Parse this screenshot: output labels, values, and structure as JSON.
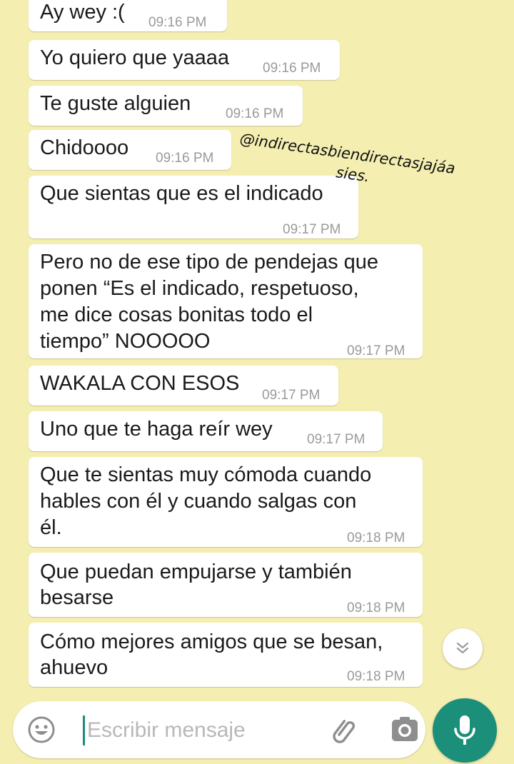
{
  "messages": [
    {
      "text": "Ay wey :(",
      "time": "09:16 PM"
    },
    {
      "text": "Yo quiero que yaaaa",
      "time": "09:16 PM"
    },
    {
      "text": "Te guste alguien",
      "time": "09:16 PM"
    },
    {
      "text": "Chidoooo",
      "time": "09:16 PM"
    },
    {
      "text": "Que sientas que es el indicado",
      "time": "09:17 PM"
    },
    {
      "lines": [
        "Pero no de ese tipo de pendejas que",
        "ponen “Es el indicado, respetuoso,",
        "me dice cosas bonitas todo el",
        "tiempo” NOOOOO"
      ],
      "time": "09:17 PM"
    },
    {
      "text": "WAKALA CON ESOS",
      "time": "09:17 PM"
    },
    {
      "text": "Uno que te haga reír wey",
      "time": "09:17 PM"
    },
    {
      "lines": [
        "Que te sientas muy cómoda cuando",
        "hables con él y cuando salgas con",
        "él."
      ],
      "time": "09:18 PM"
    },
    {
      "lines": [
        "Que puedan empujarse y también",
        "besarse"
      ],
      "time": "09:18 PM"
    },
    {
      "lines": [
        "Cómo mejores amigos que se besan,",
        "ahuevo"
      ],
      "time": "09:18 PM"
    }
  ],
  "watermark": {
    "line1": "@indirectasbiendirectasjajáa",
    "line2": "sies."
  },
  "composer": {
    "placeholder": "Escribir mensaje",
    "value": ""
  },
  "icons": {
    "emoji": "smiley-icon",
    "attach": "paperclip-icon",
    "camera": "camera-icon",
    "mic": "microphone-icon",
    "scroll": "double-chevron-down-icon"
  },
  "colors": {
    "background": "#f4eeb1",
    "bubble": "#ffffff",
    "time": "#9a9a9a",
    "accent": "#1b8f7a"
  }
}
